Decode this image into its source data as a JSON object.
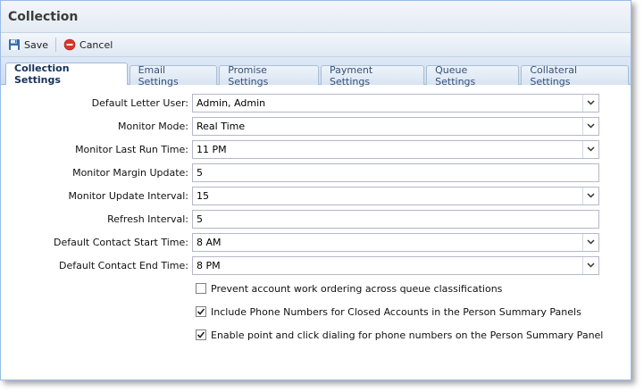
{
  "window": {
    "title": "Collection"
  },
  "toolbar": {
    "save_label": "Save",
    "cancel_label": "Cancel"
  },
  "tabs": [
    {
      "label": "Collection Settings",
      "active": true
    },
    {
      "label": "Email Settings",
      "active": false
    },
    {
      "label": "Promise Settings",
      "active": false
    },
    {
      "label": "Payment Settings",
      "active": false
    },
    {
      "label": "Queue Settings",
      "active": false
    },
    {
      "label": "Collateral Settings",
      "active": false
    }
  ],
  "form": {
    "default_letter_user": {
      "label": "Default Letter User:",
      "value": "Admin, Admin"
    },
    "monitor_mode": {
      "label": "Monitor Mode:",
      "value": "Real Time"
    },
    "monitor_last_run_time": {
      "label": "Monitor Last Run Time:",
      "value": "11 PM"
    },
    "monitor_margin_update": {
      "label": "Monitor Margin Update:",
      "value": "5"
    },
    "monitor_update_interval": {
      "label": "Monitor Update Interval:",
      "value": "15"
    },
    "refresh_interval": {
      "label": "Refresh Interval:",
      "value": "5"
    },
    "default_contact_start_time": {
      "label": "Default Contact Start Time:",
      "value": "8 AM"
    },
    "default_contact_end_time": {
      "label": "Default Contact End Time:",
      "value": "8 PM"
    }
  },
  "checkboxes": {
    "prevent_work_ordering": {
      "label": "Prevent account work ordering across queue classifications",
      "checked": false
    },
    "include_phone_numbers": {
      "label": "Include Phone Numbers for Closed Accounts in the Person Summary Panels",
      "checked": true
    },
    "enable_click_dialing": {
      "label": "Enable point and click dialing for phone numbers on the Person Summary Panel",
      "checked": true
    }
  },
  "colors": {
    "save_icon": "#3a6bb0",
    "cancel_icon": "#d9362b",
    "tab_border": "#99bbe8"
  }
}
